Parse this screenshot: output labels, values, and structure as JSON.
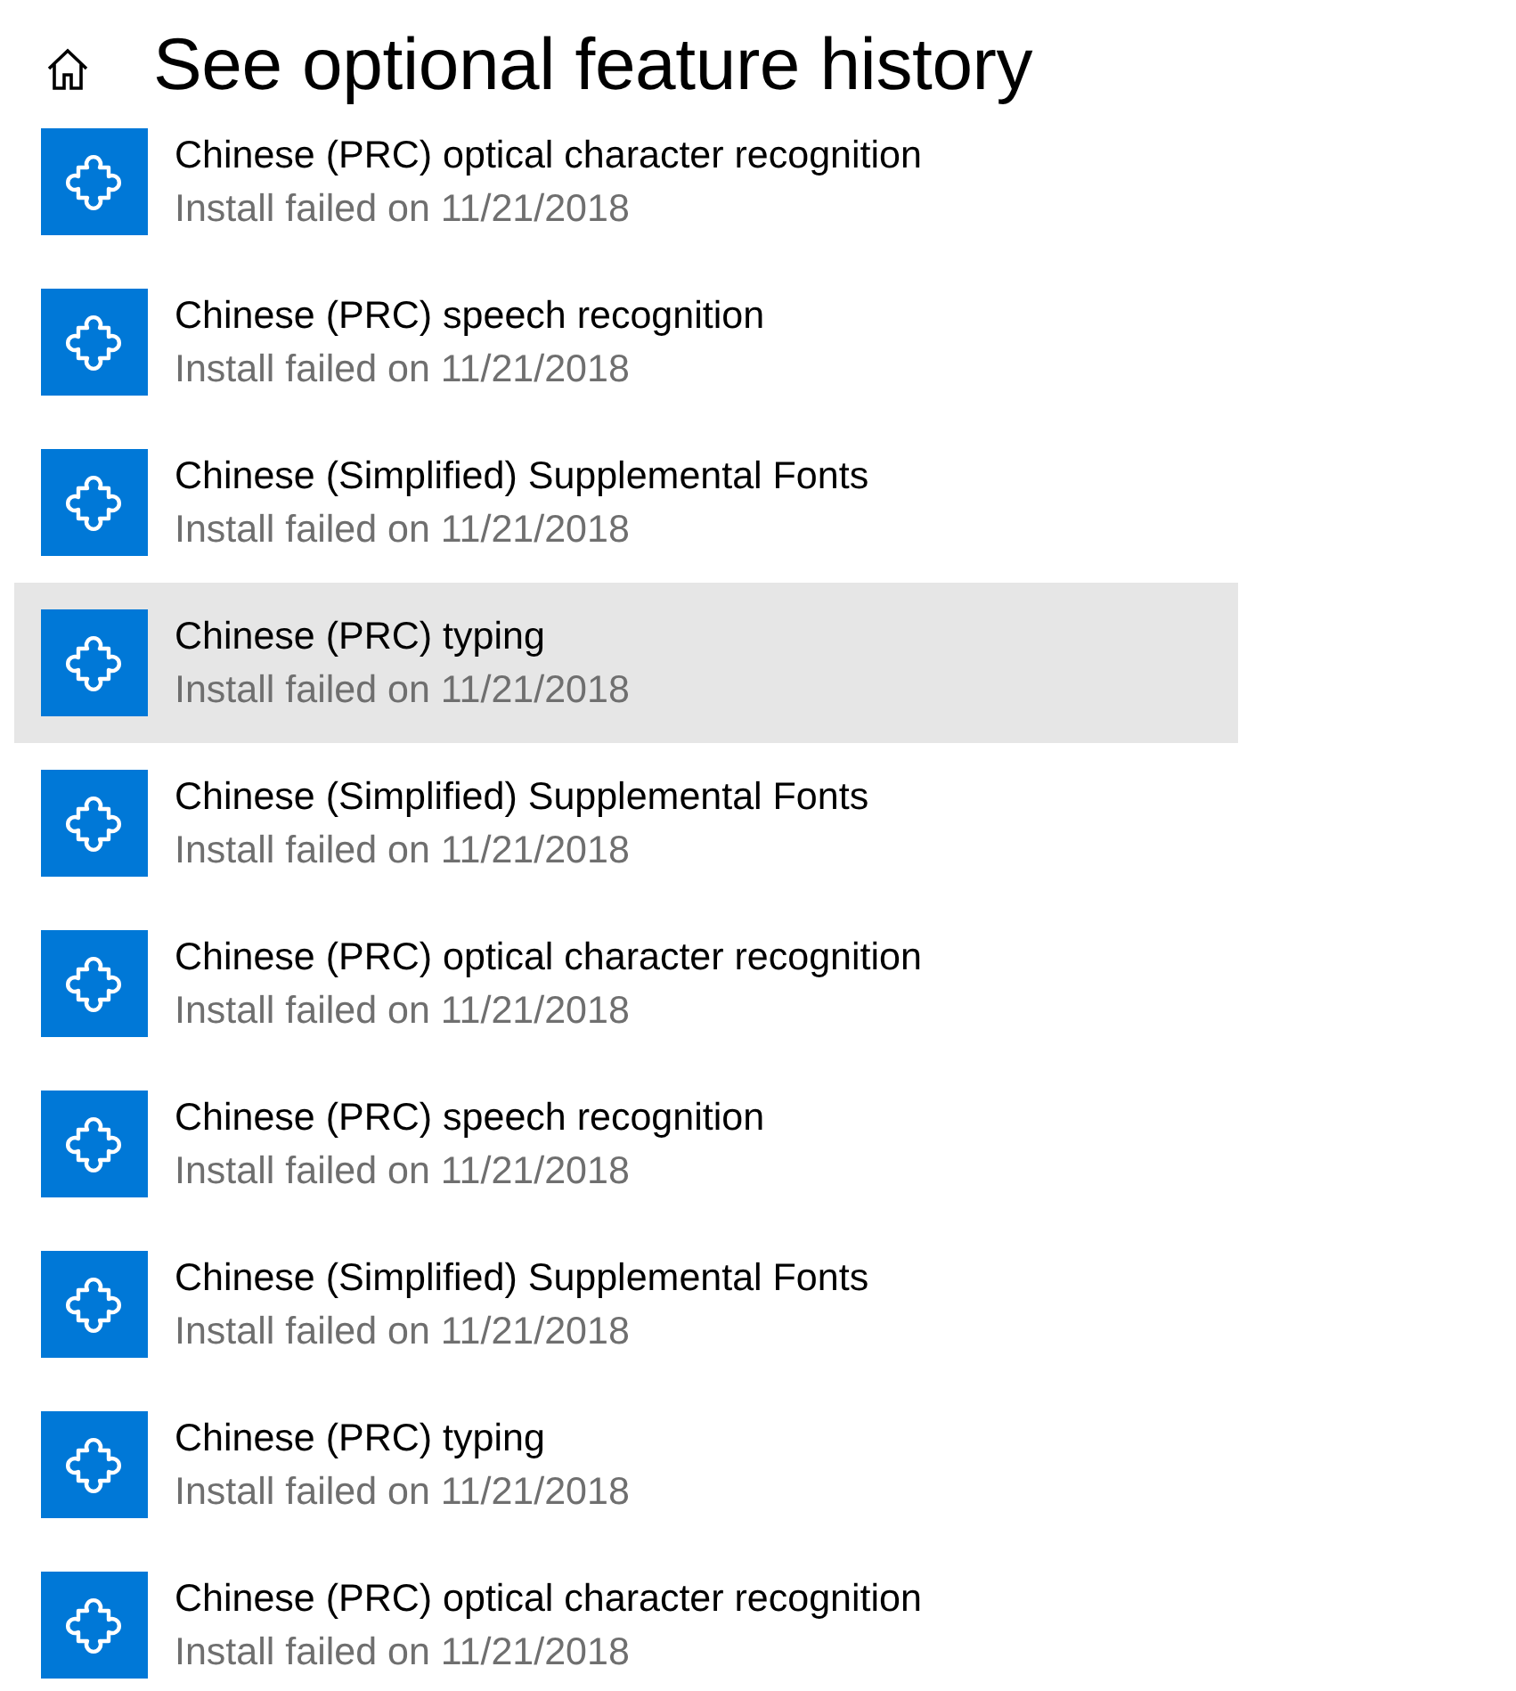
{
  "header": {
    "title": "See optional feature history"
  },
  "features": [
    {
      "name": "Chinese (PRC) optical character recognition",
      "status": "Install failed on 11/21/2018",
      "selected": false
    },
    {
      "name": "Chinese (PRC) speech recognition",
      "status": "Install failed on 11/21/2018",
      "selected": false
    },
    {
      "name": "Chinese (Simplified) Supplemental Fonts",
      "status": "Install failed on 11/21/2018",
      "selected": false
    },
    {
      "name": "Chinese (PRC) typing",
      "status": "Install failed on 11/21/2018",
      "selected": true
    },
    {
      "name": "Chinese (Simplified) Supplemental Fonts",
      "status": "Install failed on 11/21/2018",
      "selected": false
    },
    {
      "name": "Chinese (PRC) optical character recognition",
      "status": "Install failed on 11/21/2018",
      "selected": false
    },
    {
      "name": "Chinese (PRC) speech recognition",
      "status": "Install failed on 11/21/2018",
      "selected": false
    },
    {
      "name": "Chinese (Simplified) Supplemental Fonts",
      "status": "Install failed on 11/21/2018",
      "selected": false
    },
    {
      "name": "Chinese (PRC) typing",
      "status": "Install failed on 11/21/2018",
      "selected": false
    },
    {
      "name": "Chinese (PRC) optical character recognition",
      "status": "Install failed on 11/21/2018",
      "selected": false
    }
  ]
}
